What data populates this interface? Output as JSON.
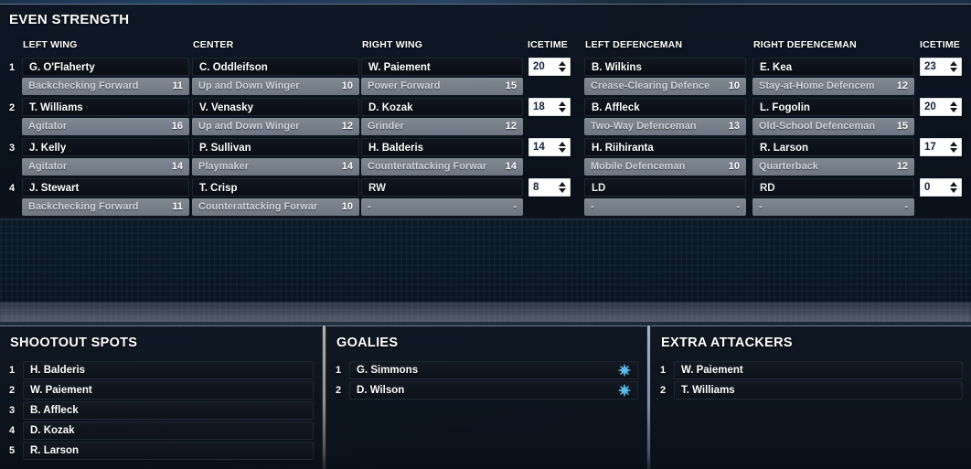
{
  "top_panel": {
    "title": "EVEN STRENGTH",
    "columns": [
      {
        "key": "lw",
        "label": "LEFT WING"
      },
      {
        "key": "c",
        "label": "CENTER"
      },
      {
        "key": "rw",
        "label": "RIGHT WING"
      },
      {
        "key": "icetime_f",
        "label": "ICETIME"
      },
      {
        "key": "ld",
        "label": "LEFT DEFENCEMAN"
      },
      {
        "key": "rd",
        "label": "RIGHT DEFENCEMAN"
      },
      {
        "key": "icetime_d",
        "label": "ICETIME"
      }
    ],
    "lines": [
      {
        "number": "1",
        "lw": {
          "name": "G. O'Flaherty",
          "role": "Backchecking Forward",
          "rating": "11",
          "empty": false
        },
        "c": {
          "name": "C. Oddleifson",
          "role": "Up and Down Winger",
          "rating": "10",
          "empty": false
        },
        "rw": {
          "name": "W. Paiement",
          "role": "Power Forward",
          "rating": "15",
          "empty": false
        },
        "icetime_f": "20",
        "ld": {
          "name": "B. Wilkins",
          "role": "Crease-Clearing Defence",
          "rating": "10",
          "empty": false
        },
        "rd": {
          "name": "E. Kea",
          "role": "Stay-at-Home Defencem",
          "rating": "12",
          "empty": false
        },
        "icetime_d": "23"
      },
      {
        "number": "2",
        "lw": {
          "name": "T. Williams",
          "role": "Agitator",
          "rating": "16",
          "empty": false
        },
        "c": {
          "name": "V. Venasky",
          "role": "Up and Down Winger",
          "rating": "12",
          "empty": false
        },
        "rw": {
          "name": "D. Kozak",
          "role": "Grinder",
          "rating": "12",
          "empty": false
        },
        "icetime_f": "18",
        "ld": {
          "name": "B. Affleck",
          "role": "Two-Way Defenceman",
          "rating": "13",
          "empty": false
        },
        "rd": {
          "name": "L. Fogolin",
          "role": "Old-School Defenceman",
          "rating": "15",
          "empty": false
        },
        "icetime_d": "20"
      },
      {
        "number": "3",
        "lw": {
          "name": "J. Kelly",
          "role": "Agitator",
          "rating": "14",
          "empty": false
        },
        "c": {
          "name": "P. Sullivan",
          "role": "Playmaker",
          "rating": "14",
          "empty": false
        },
        "rw": {
          "name": "H. Balderis",
          "role": "Counterattacking Forwar",
          "rating": "14",
          "empty": false
        },
        "icetime_f": "14",
        "ld": {
          "name": "H. Riihiranta",
          "role": "Mobile Defenceman",
          "rating": "10",
          "empty": false
        },
        "rd": {
          "name": "R. Larson",
          "role": "Quarterback",
          "rating": "12",
          "empty": false
        },
        "icetime_d": "17"
      },
      {
        "number": "4",
        "lw": {
          "name": "J. Stewart",
          "role": "Backchecking Forward",
          "rating": "11",
          "empty": false
        },
        "c": {
          "name": "T. Crisp",
          "role": "Counterattacking Forwar",
          "rating": "10",
          "empty": false
        },
        "rw": {
          "name": "RW",
          "role": "-",
          "rating": "-",
          "empty": true
        },
        "icetime_f": "8",
        "ld": {
          "name": "LD",
          "role": "-",
          "rating": "-",
          "empty": true
        },
        "rd": {
          "name": "RD",
          "role": "-",
          "rating": "-",
          "empty": true
        },
        "icetime_d": "0"
      }
    ]
  },
  "shootout": {
    "title": "SHOOTOUT SPOTS",
    "rows": [
      {
        "number": "1",
        "name": "H. Balderis"
      },
      {
        "number": "2",
        "name": "W. Paiement"
      },
      {
        "number": "3",
        "name": "B. Affleck"
      },
      {
        "number": "4",
        "name": "D. Kozak"
      },
      {
        "number": "5",
        "name": "R. Larson"
      }
    ]
  },
  "goalies": {
    "title": "GOALIES",
    "rows": [
      {
        "number": "1",
        "name": "G. Simmons",
        "icon": "snowflake-icon"
      },
      {
        "number": "2",
        "name": "D. Wilson",
        "icon": "snowflake-icon"
      }
    ]
  },
  "extra_attackers": {
    "title": "EXTRA ATTACKERS",
    "rows": [
      {
        "number": "1",
        "name": "W. Paiement"
      },
      {
        "number": "2",
        "name": "T. Williams"
      }
    ]
  },
  "colors": {
    "accent_snowflake": "#5ec0ef",
    "panel_bg": "#0c1420",
    "name_row_bg": "#101620",
    "role_row_bg": "#8e97a3",
    "spinner_bg": "#ffffff",
    "spinner_text": "#15233a",
    "text_primary": "#ffffff",
    "text_role": "#cfd6de",
    "divider_warm": "#d6c4b0"
  }
}
